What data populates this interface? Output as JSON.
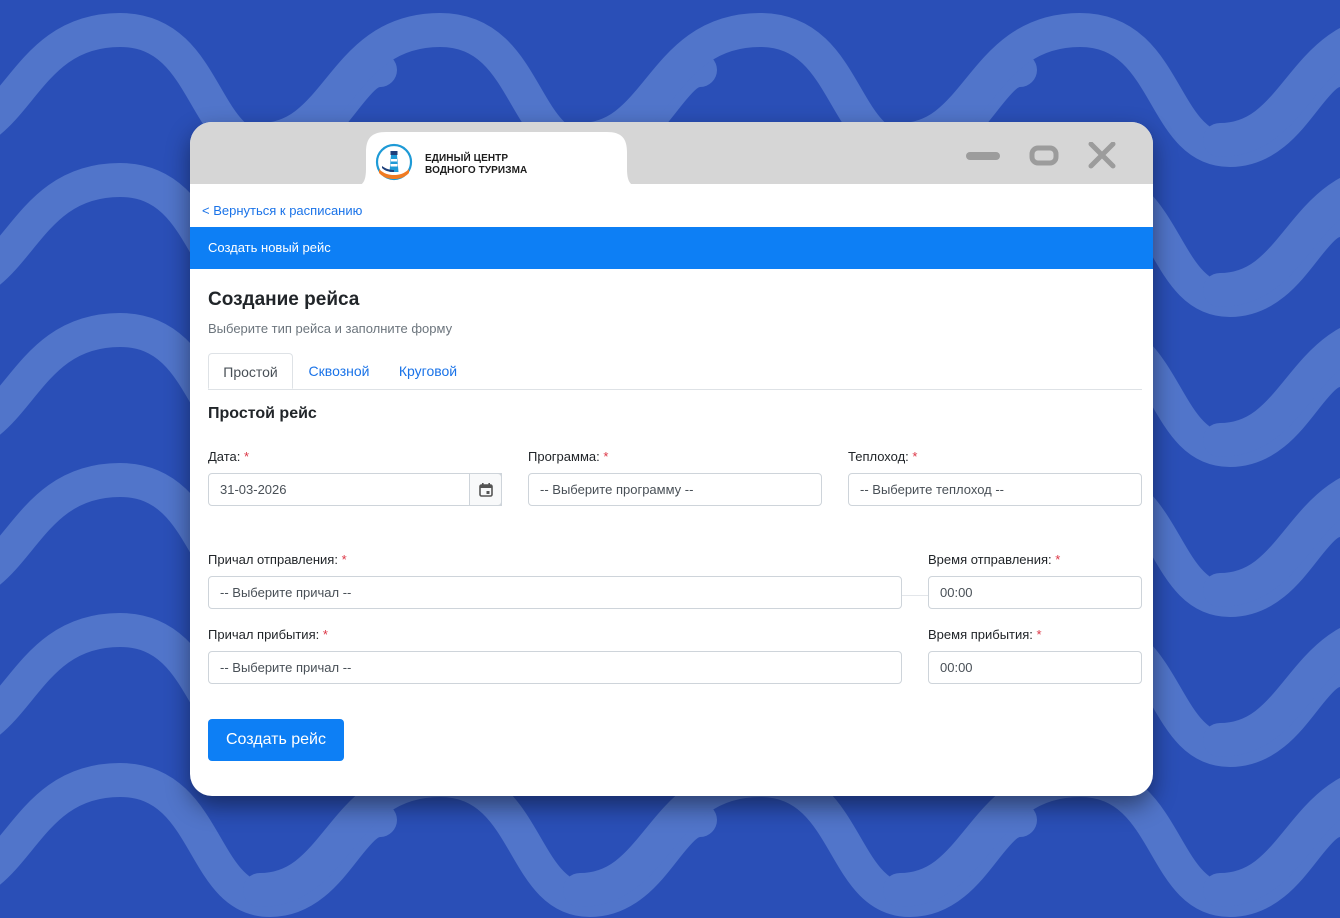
{
  "brand": {
    "logo_line1": "ЕДИНЫЙ ЦЕНТР",
    "logo_line2": "ВОДНОГО ТУРИЗМА",
    "logo_icon": "lighthouse-logo-icon"
  },
  "window_controls": {
    "minimize": "minimize-icon",
    "maximize": "maximize-icon",
    "close": "close-icon"
  },
  "nav": {
    "back_link": "< Вернуться к расписанию"
  },
  "header": {
    "title": "Создать новый рейс"
  },
  "page": {
    "title": "Создание рейса",
    "subtitle": "Выберите тип рейса и заполните форму"
  },
  "tabs": [
    {
      "label": "Простой",
      "active": true
    },
    {
      "label": "Сквозной",
      "active": false
    },
    {
      "label": "Круговой",
      "active": false
    }
  ],
  "form": {
    "section_title": "Простой рейс",
    "required_mark": "*",
    "date": {
      "label": "Дата:",
      "value": "31-03-2026",
      "button_icon": "calendar-icon"
    },
    "program": {
      "label": "Программа:",
      "value": "-- Выберите программу --"
    },
    "ship": {
      "label": "Теплоход:",
      "value": "-- Выберите теплоход --"
    },
    "departure_pier": {
      "label": "Причал отправления:",
      "value": "-- Выберите причал --"
    },
    "departure_time": {
      "label": "Время отправления:",
      "value": "00:00"
    },
    "arrival_pier": {
      "label": "Причал прибытия:",
      "value": "-- Выберите причал --"
    },
    "arrival_time": {
      "label": "Время прибытия:",
      "value": "00:00"
    },
    "submit_label": "Создать рейс"
  },
  "colors": {
    "background": "#2a4fb7",
    "accent": "#0d7ff5",
    "link": "#1a73e8",
    "required": "#dc3545",
    "titlebar": "#d6d6d6"
  }
}
